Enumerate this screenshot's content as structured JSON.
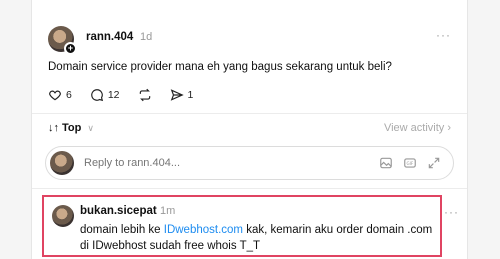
{
  "post": {
    "username": "rann.404",
    "time": "1d",
    "text": "Domain service provider mana eh yang bagus sekarang untuk beli?",
    "likes": "6",
    "comments": "12",
    "shares": "1",
    "more": "···"
  },
  "sort": {
    "label": "Top",
    "view_activity": "View activity ›"
  },
  "reply": {
    "placeholder": "Reply to rann.404..."
  },
  "comment": {
    "username": "bukan.sicepat",
    "time": "1m",
    "text_before": "domain lebih ke ",
    "link": "IDwebhost.com",
    "text_after": " kak, kemarin aku order domain .com di IDwebhost sudah free whois T_T",
    "more": "···"
  },
  "colors": {
    "highlight_border": "#e04462",
    "link": "#1d8cf0"
  }
}
